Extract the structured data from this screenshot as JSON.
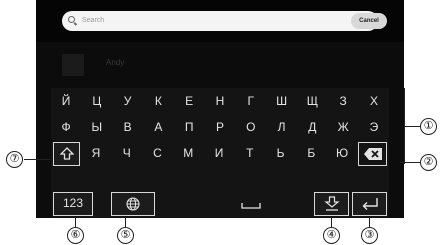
{
  "search": {
    "placeholder": "Search",
    "cancel_label": "Cancel"
  },
  "contact": {
    "name": "Andy"
  },
  "keyboard": {
    "rows": [
      [
        "Й",
        "Ц",
        "У",
        "К",
        "Е",
        "Н",
        "Г",
        "Ш",
        "Щ",
        "З",
        "Х"
      ],
      [
        "Ф",
        "Ы",
        "В",
        "А",
        "П",
        "Р",
        "О",
        "Л",
        "Д",
        "Ж",
        "Э"
      ],
      [
        "Я",
        "Ч",
        "С",
        "М",
        "И",
        "Т",
        "Ь",
        "Б",
        "Ю"
      ]
    ],
    "numbers_label": "123",
    "shift_icon": "shift-icon",
    "backspace_icon": "backspace-icon",
    "language_icon": "globe-icon",
    "space_icon": "space-icon",
    "hide_keyboard_icon": "hide-keyboard-icon",
    "enter_icon": "enter-icon"
  },
  "callouts": [
    "①",
    "②",
    "③",
    "④",
    "⑤",
    "⑥",
    "⑦"
  ]
}
